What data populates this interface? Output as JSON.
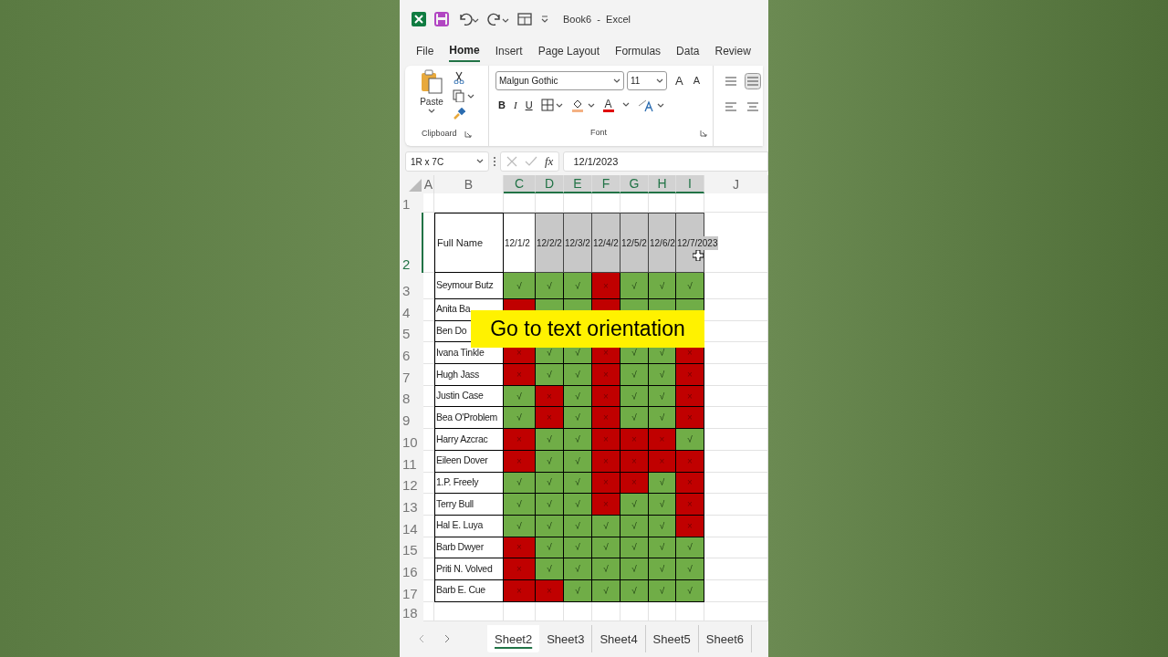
{
  "window": {
    "title": "Book6  -  Excel"
  },
  "ribbon_tabs": [
    {
      "label": "File",
      "selected": false
    },
    {
      "label": "Home",
      "selected": true
    },
    {
      "label": "Insert",
      "selected": false
    },
    {
      "label": "Page Layout",
      "selected": false
    },
    {
      "label": "Formulas",
      "selected": false
    },
    {
      "label": "Data",
      "selected": false
    },
    {
      "label": "Review",
      "selected": false
    }
  ],
  "clipboard": {
    "paste": "Paste",
    "group": "Clipboard"
  },
  "font": {
    "name": "Malgun Gothic",
    "size": "11",
    "grow": "A",
    "shrink": "A",
    "bold": "B",
    "italic": "I",
    "underline": "U",
    "font_color_label": "A",
    "group": "Font"
  },
  "formula_bar": {
    "name_box": "1R x 7C",
    "fx": "fx",
    "value": "12/1/2023"
  },
  "columns": [
    {
      "label": "A",
      "selected": false
    },
    {
      "label": "B",
      "selected": false
    },
    {
      "label": "C",
      "selected": true
    },
    {
      "label": "D",
      "selected": true
    },
    {
      "label": "E",
      "selected": true
    },
    {
      "label": "F",
      "selected": true
    },
    {
      "label": "G",
      "selected": true
    },
    {
      "label": "H",
      "selected": true
    },
    {
      "label": "I",
      "selected": true
    },
    {
      "label": "J",
      "selected": false
    }
  ],
  "rows": [
    {
      "kind": "blank",
      "number": "1",
      "selected": false
    },
    {
      "kind": "header",
      "number": "2",
      "selected": true,
      "name": "Full Name",
      "dates": [
        {
          "text": "12/1/2",
          "active": true
        },
        {
          "text": "12/2/2",
          "active": false
        },
        {
          "text": "12/3/2",
          "active": false
        },
        {
          "text": "12/4/2",
          "active": false
        },
        {
          "text": "12/5/2",
          "active": false
        },
        {
          "text": "12/6/2",
          "active": false
        },
        {
          "text": "12/7/2023",
          "active": false
        }
      ]
    },
    {
      "kind": "data",
      "number": "3",
      "selected": false,
      "name": "Seymour Butz",
      "cells": [
        {
          "ok": true,
          "mark": "√"
        },
        {
          "ok": true,
          "mark": "√"
        },
        {
          "ok": true,
          "mark": "√"
        },
        {
          "ok": false,
          "mark": "×"
        },
        {
          "ok": true,
          "mark": "√"
        },
        {
          "ok": true,
          "mark": "√"
        },
        {
          "ok": true,
          "mark": "√"
        }
      ]
    },
    {
      "kind": "data",
      "number": "4",
      "selected": false,
      "name": "Anita Ba",
      "cells": [
        {
          "ok": false
        },
        {
          "ok": true
        },
        {
          "ok": true
        },
        {
          "ok": false
        },
        {
          "ok": true
        },
        {
          "ok": true
        },
        {
          "ok": true
        }
      ]
    },
    {
      "kind": "data",
      "number": "5",
      "selected": false,
      "name": "Ben Do"
    },
    {
      "kind": "data",
      "number": "6",
      "selected": false,
      "name": "Ivana Tinkle",
      "cells": [
        {
          "ok": false,
          "mark": "×"
        },
        {
          "ok": true,
          "mark": "√"
        },
        {
          "ok": true,
          "mark": "√"
        },
        {
          "ok": false,
          "mark": "×"
        },
        {
          "ok": true,
          "mark": "√"
        },
        {
          "ok": true,
          "mark": "√"
        },
        {
          "ok": false,
          "mark": "×"
        }
      ]
    },
    {
      "kind": "data",
      "number": "7",
      "selected": false,
      "name": "Hugh Jass",
      "cells": [
        {
          "ok": false,
          "mark": "×"
        },
        {
          "ok": true,
          "mark": "√"
        },
        {
          "ok": true,
          "mark": "√"
        },
        {
          "ok": false,
          "mark": "×"
        },
        {
          "ok": true,
          "mark": "√"
        },
        {
          "ok": true,
          "mark": "√"
        },
        {
          "ok": false,
          "mark": "×"
        }
      ]
    },
    {
      "kind": "data",
      "number": "8",
      "selected": false,
      "name": "Justin Case",
      "cells": [
        {
          "ok": true,
          "mark": "√"
        },
        {
          "ok": false,
          "mark": "×"
        },
        {
          "ok": true,
          "mark": "√"
        },
        {
          "ok": false,
          "mark": "×"
        },
        {
          "ok": true,
          "mark": "√"
        },
        {
          "ok": true,
          "mark": "√"
        },
        {
          "ok": false,
          "mark": "×"
        }
      ]
    },
    {
      "kind": "data",
      "number": "9",
      "selected": false,
      "name": "Bea O'Problem",
      "cells": [
        {
          "ok": true,
          "mark": "√"
        },
        {
          "ok": false,
          "mark": "×"
        },
        {
          "ok": true,
          "mark": "√"
        },
        {
          "ok": false,
          "mark": "×"
        },
        {
          "ok": true,
          "mark": "√"
        },
        {
          "ok": true,
          "mark": "√"
        },
        {
          "ok": false,
          "mark": "×"
        }
      ]
    },
    {
      "kind": "data",
      "number": "10",
      "selected": false,
      "name": "Harry Azcrac",
      "cells": [
        {
          "ok": false,
          "mark": "×"
        },
        {
          "ok": true,
          "mark": "√"
        },
        {
          "ok": true,
          "mark": "√"
        },
        {
          "ok": false,
          "mark": "×"
        },
        {
          "ok": false,
          "mark": "×"
        },
        {
          "ok": false,
          "mark": "×"
        },
        {
          "ok": true,
          "mark": "√"
        }
      ]
    },
    {
      "kind": "data",
      "number": "11",
      "selected": false,
      "name": "Eileen Dover",
      "cells": [
        {
          "ok": false,
          "mark": "×"
        },
        {
          "ok": true,
          "mark": "√"
        },
        {
          "ok": true,
          "mark": "√"
        },
        {
          "ok": false,
          "mark": "×"
        },
        {
          "ok": false,
          "mark": "×"
        },
        {
          "ok": false,
          "mark": "×"
        },
        {
          "ok": false,
          "mark": "×"
        }
      ]
    },
    {
      "kind": "data",
      "number": "12",
      "selected": false,
      "name": "1.P. Freely",
      "cells": [
        {
          "ok": true,
          "mark": "√"
        },
        {
          "ok": true,
          "mark": "√"
        },
        {
          "ok": true,
          "mark": "√"
        },
        {
          "ok": false,
          "mark": "×"
        },
        {
          "ok": false,
          "mark": "×"
        },
        {
          "ok": true,
          "mark": "√"
        },
        {
          "ok": false,
          "mark": "×"
        }
      ]
    },
    {
      "kind": "data",
      "number": "13",
      "selected": false,
      "name": "Terry Bull",
      "cells": [
        {
          "ok": true,
          "mark": "√"
        },
        {
          "ok": true,
          "mark": "√"
        },
        {
          "ok": true,
          "mark": "√"
        },
        {
          "ok": false,
          "mark": "×"
        },
        {
          "ok": true,
          "mark": "√"
        },
        {
          "ok": true,
          "mark": "√"
        },
        {
          "ok": false,
          "mark": "×"
        }
      ]
    },
    {
      "kind": "data",
      "number": "14",
      "selected": false,
      "name": "Hal E. Luya",
      "cells": [
        {
          "ok": true,
          "mark": "√"
        },
        {
          "ok": true,
          "mark": "√"
        },
        {
          "ok": true,
          "mark": "√"
        },
        {
          "ok": true,
          "mark": "√"
        },
        {
          "ok": true,
          "mark": "√"
        },
        {
          "ok": true,
          "mark": "√"
        },
        {
          "ok": false,
          "mark": "×"
        }
      ]
    },
    {
      "kind": "data",
      "number": "15",
      "selected": false,
      "name": "Barb Dwyer",
      "cells": [
        {
          "ok": false,
          "mark": "×"
        },
        {
          "ok": true,
          "mark": "√"
        },
        {
          "ok": true,
          "mark": "√"
        },
        {
          "ok": true,
          "mark": "√"
        },
        {
          "ok": true,
          "mark": "√"
        },
        {
          "ok": true,
          "mark": "√"
        },
        {
          "ok": true,
          "mark": "√"
        }
      ]
    },
    {
      "kind": "data",
      "number": "16",
      "selected": false,
      "name": "Priti N. Volved",
      "cells": [
        {
          "ok": false,
          "mark": "×"
        },
        {
          "ok": true,
          "mark": "√"
        },
        {
          "ok": true,
          "mark": "√"
        },
        {
          "ok": true,
          "mark": "√"
        },
        {
          "ok": true,
          "mark": "√"
        },
        {
          "ok": true,
          "mark": "√"
        },
        {
          "ok": true,
          "mark": "√"
        }
      ]
    },
    {
      "kind": "data",
      "number": "17",
      "selected": false,
      "name": "Barb E. Cue",
      "cells": [
        {
          "ok": false,
          "mark": "×"
        },
        {
          "ok": false,
          "mark": "×"
        },
        {
          "ok": true,
          "mark": "√"
        },
        {
          "ok": true,
          "mark": "√"
        },
        {
          "ok": true,
          "mark": "√"
        },
        {
          "ok": true,
          "mark": "√"
        },
        {
          "ok": true,
          "mark": "√"
        }
      ]
    },
    {
      "kind": "blank",
      "number": "18",
      "selected": false
    }
  ],
  "sheet_tabs": [
    {
      "label": "Sheet2",
      "selected": true
    },
    {
      "label": "Sheet3",
      "selected": false
    },
    {
      "label": "Sheet4",
      "selected": false
    },
    {
      "label": "Sheet5",
      "selected": false
    },
    {
      "label": "Sheet6",
      "selected": false
    }
  ],
  "caption": "Go to text orientation"
}
